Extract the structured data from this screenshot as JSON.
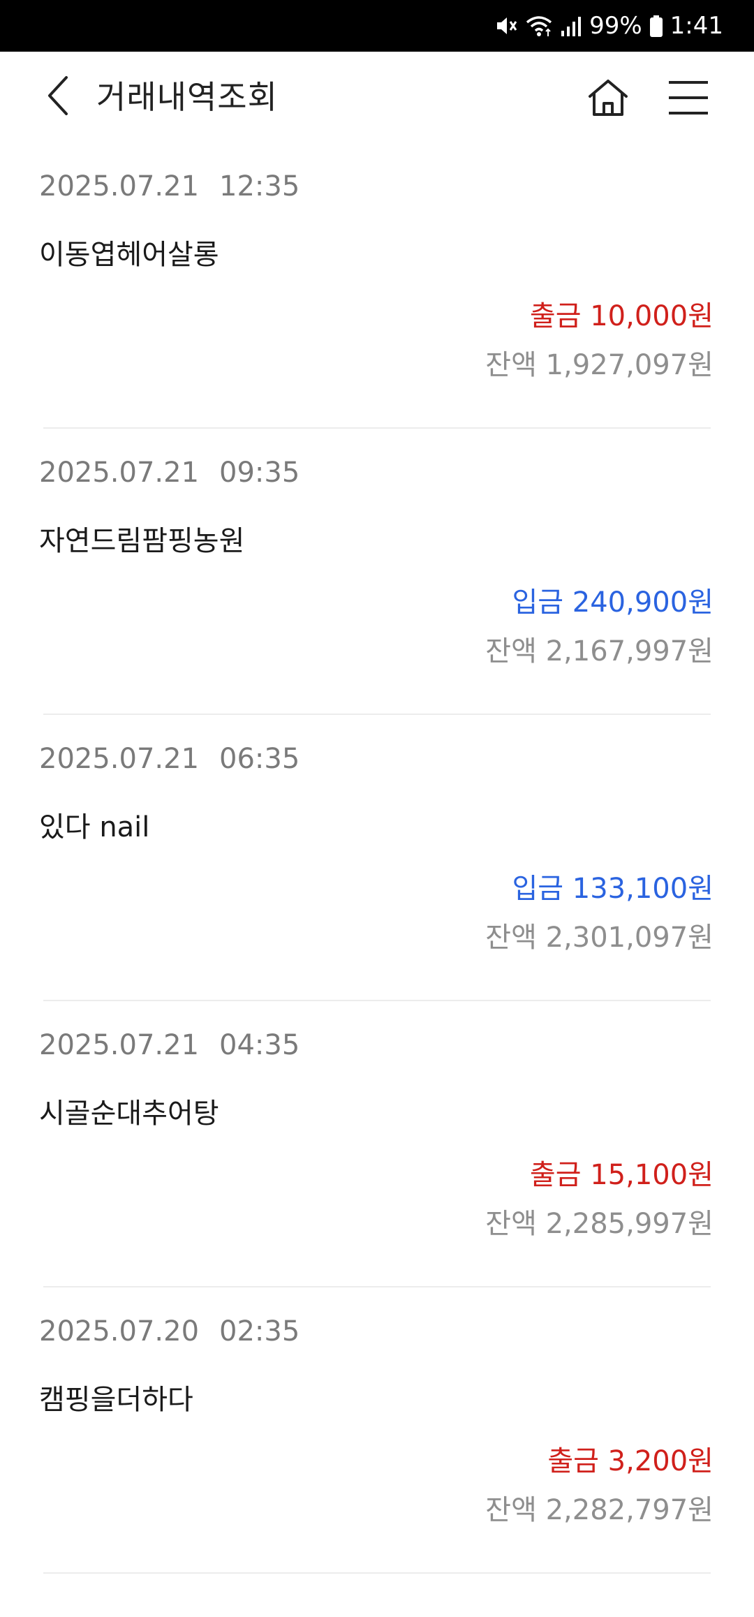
{
  "status_bar": {
    "battery": "99%",
    "time": "1:41",
    "icons": [
      "mute-icon",
      "wifi-icon",
      "signal-icon",
      "battery-icon"
    ]
  },
  "header": {
    "title": "거래내역조회",
    "icons": [
      "back-icon",
      "home-icon",
      "menu-icon"
    ]
  },
  "colors": {
    "withdrawal": "#d0201b",
    "deposit": "#2a63e0"
  },
  "transactions": [
    {
      "date": "2025.07.21",
      "time": "12:35",
      "merchant": "이동엽헤어살롱",
      "type": "out",
      "amount": "출금 10,000원",
      "balance": "잔액 1,927,097원"
    },
    {
      "date": "2025.07.21",
      "time": "09:35",
      "merchant": "자연드림팜핑농원",
      "type": "in",
      "amount": "입금 240,900원",
      "balance": "잔액 2,167,997원"
    },
    {
      "date": "2025.07.21",
      "time": "06:35",
      "merchant": "있다 nail",
      "type": "in",
      "amount": "입금 133,100원",
      "balance": "잔액 2,301,097원"
    },
    {
      "date": "2025.07.21",
      "time": "04:35",
      "merchant": "시골순대추어탕",
      "type": "out",
      "amount": "출금 15,100원",
      "balance": "잔액 2,285,997원"
    },
    {
      "date": "2025.07.20",
      "time": "02:35",
      "merchant": "캠핑을더하다",
      "type": "out",
      "amount": "출금 3,200원",
      "balance": "잔액 2,282,797원"
    }
  ]
}
